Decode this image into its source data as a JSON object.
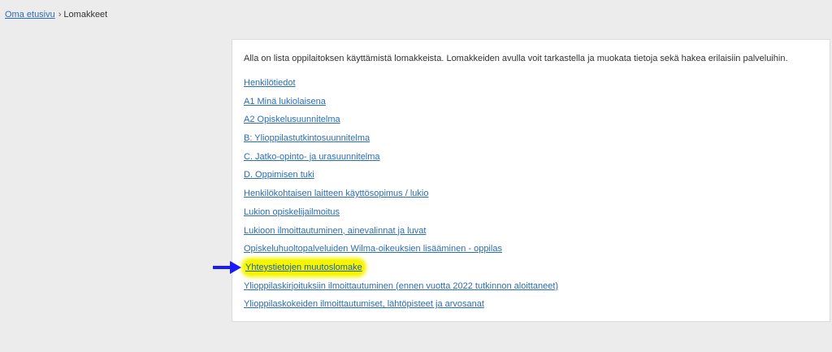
{
  "breadcrumb": {
    "home_label": "Oma etusivu",
    "separator": "›",
    "current_label": "Lomakkeet"
  },
  "forms_panel": {
    "intro": "Alla on lista oppilaitoksen käyttämistä lomakkeista. Lomakkeiden avulla voit tarkastella ja muokata tietoja sekä hakea erilaisiin palveluihin.",
    "links": [
      {
        "label": "Henkilötiedot"
      },
      {
        "label": "A1 Minä lukiolaisena"
      },
      {
        "label": "A2 Opiskelusuunnitelma"
      },
      {
        "label": "B: Ylioppilastutkintosuunnitelma"
      },
      {
        "label": "C. Jatko-opinto- ja urasuunnitelma"
      },
      {
        "label": "D. Oppimisen tuki"
      },
      {
        "label": "Henkilökohtaisen laitteen käyttösopimus / lukio"
      },
      {
        "label": "Lukion opiskelijailmoitus"
      },
      {
        "label": "Lukioon ilmoittautuminen, ainevalinnat ja luvat"
      },
      {
        "label": "Opiskeluhuoltopalveluiden Wilma-oikeuksien lisääminen - oppilas"
      },
      {
        "label": "Yhteystietojen muutoslomake",
        "highlighted": true
      },
      {
        "label": "Ylioppilaskirjoituksiin ilmoittautuminen (ennen vuotta 2022 tutkinnon aloittaneet)"
      },
      {
        "label": "Ylioppilaskokeiden ilmoittautumiset, lähtöpisteet ja arvosanat"
      }
    ]
  },
  "annotation": {
    "arrow_color": "#1a1aff",
    "highlight_color": "#f5f500",
    "arrow_icon": "arrow-right-icon"
  }
}
